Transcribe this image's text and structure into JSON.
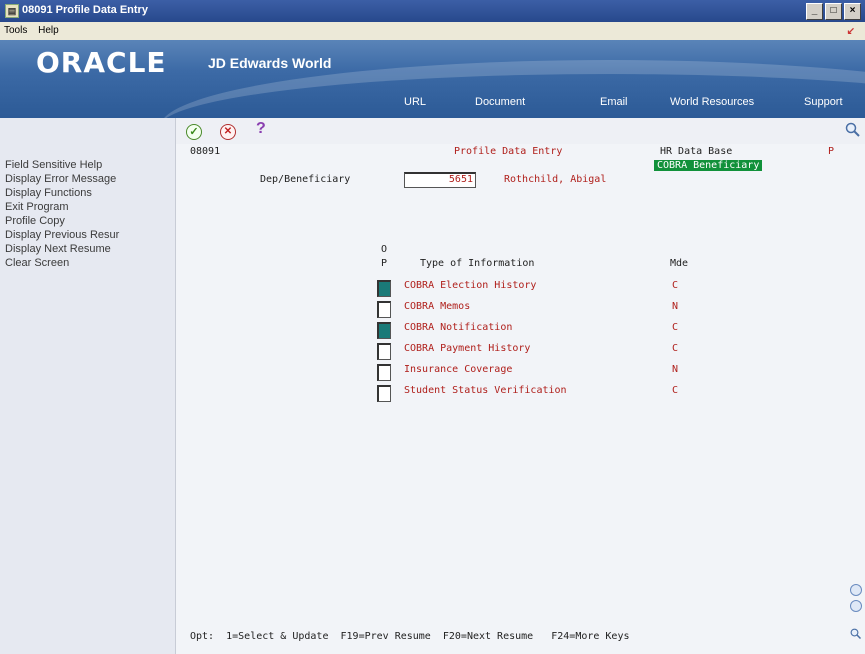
{
  "window": {
    "title": "08091   Profile Data Entry",
    "controls": [
      "_",
      "□",
      "×"
    ]
  },
  "menubar": {
    "items": [
      "Tools",
      "Help"
    ]
  },
  "banner": {
    "logo": "ORACLE",
    "product": "JD Edwards World",
    "nav": [
      "URL",
      "Document",
      "Email",
      "World Resources",
      "Support"
    ]
  },
  "sidebar": {
    "items": [
      "Field Sensitive Help",
      "Display Error Message",
      "Display Functions",
      "Exit Program",
      "Profile Copy",
      "Display Previous Resur",
      "Display Next Resume",
      "Clear Screen"
    ]
  },
  "toolbar": {
    "ok_icon": "check-icon",
    "cancel_icon": "cancel-icon",
    "help_label": "?"
  },
  "form": {
    "program_id": "08091",
    "title": "Profile Data Entry",
    "database": "HR Data Base",
    "mode_flag": "P",
    "badge": "COBRA Beneficiary",
    "dep_label": "Dep/Beneficiary",
    "dep_value": "5651",
    "dep_name": "Rothchild, Abigal",
    "col_op_top": "O",
    "col_op_bottom": "P",
    "col_type": "Type of Information",
    "col_mode": "Mde",
    "rows": [
      {
        "label": "COBRA Election History",
        "mode": "C",
        "filled": true
      },
      {
        "label": "COBRA Memos",
        "mode": "N",
        "filled": false
      },
      {
        "label": "COBRA Notification",
        "mode": "C",
        "filled": true
      },
      {
        "label": "COBRA Payment History",
        "mode": "C",
        "filled": false
      },
      {
        "label": "Insurance Coverage",
        "mode": "N",
        "filled": false
      },
      {
        "label": "Student Status Verification",
        "mode": "C",
        "filled": false
      }
    ],
    "footer": "Opt:  1=Select & Update  F19=Prev Resume  F20=Next Resume   F24=More Keys"
  },
  "colors": {
    "accent_red": "#b0201c",
    "badge_green": "#11913a",
    "selected_teal": "#1a7a78",
    "banner_blue": "#3c6aa6"
  }
}
